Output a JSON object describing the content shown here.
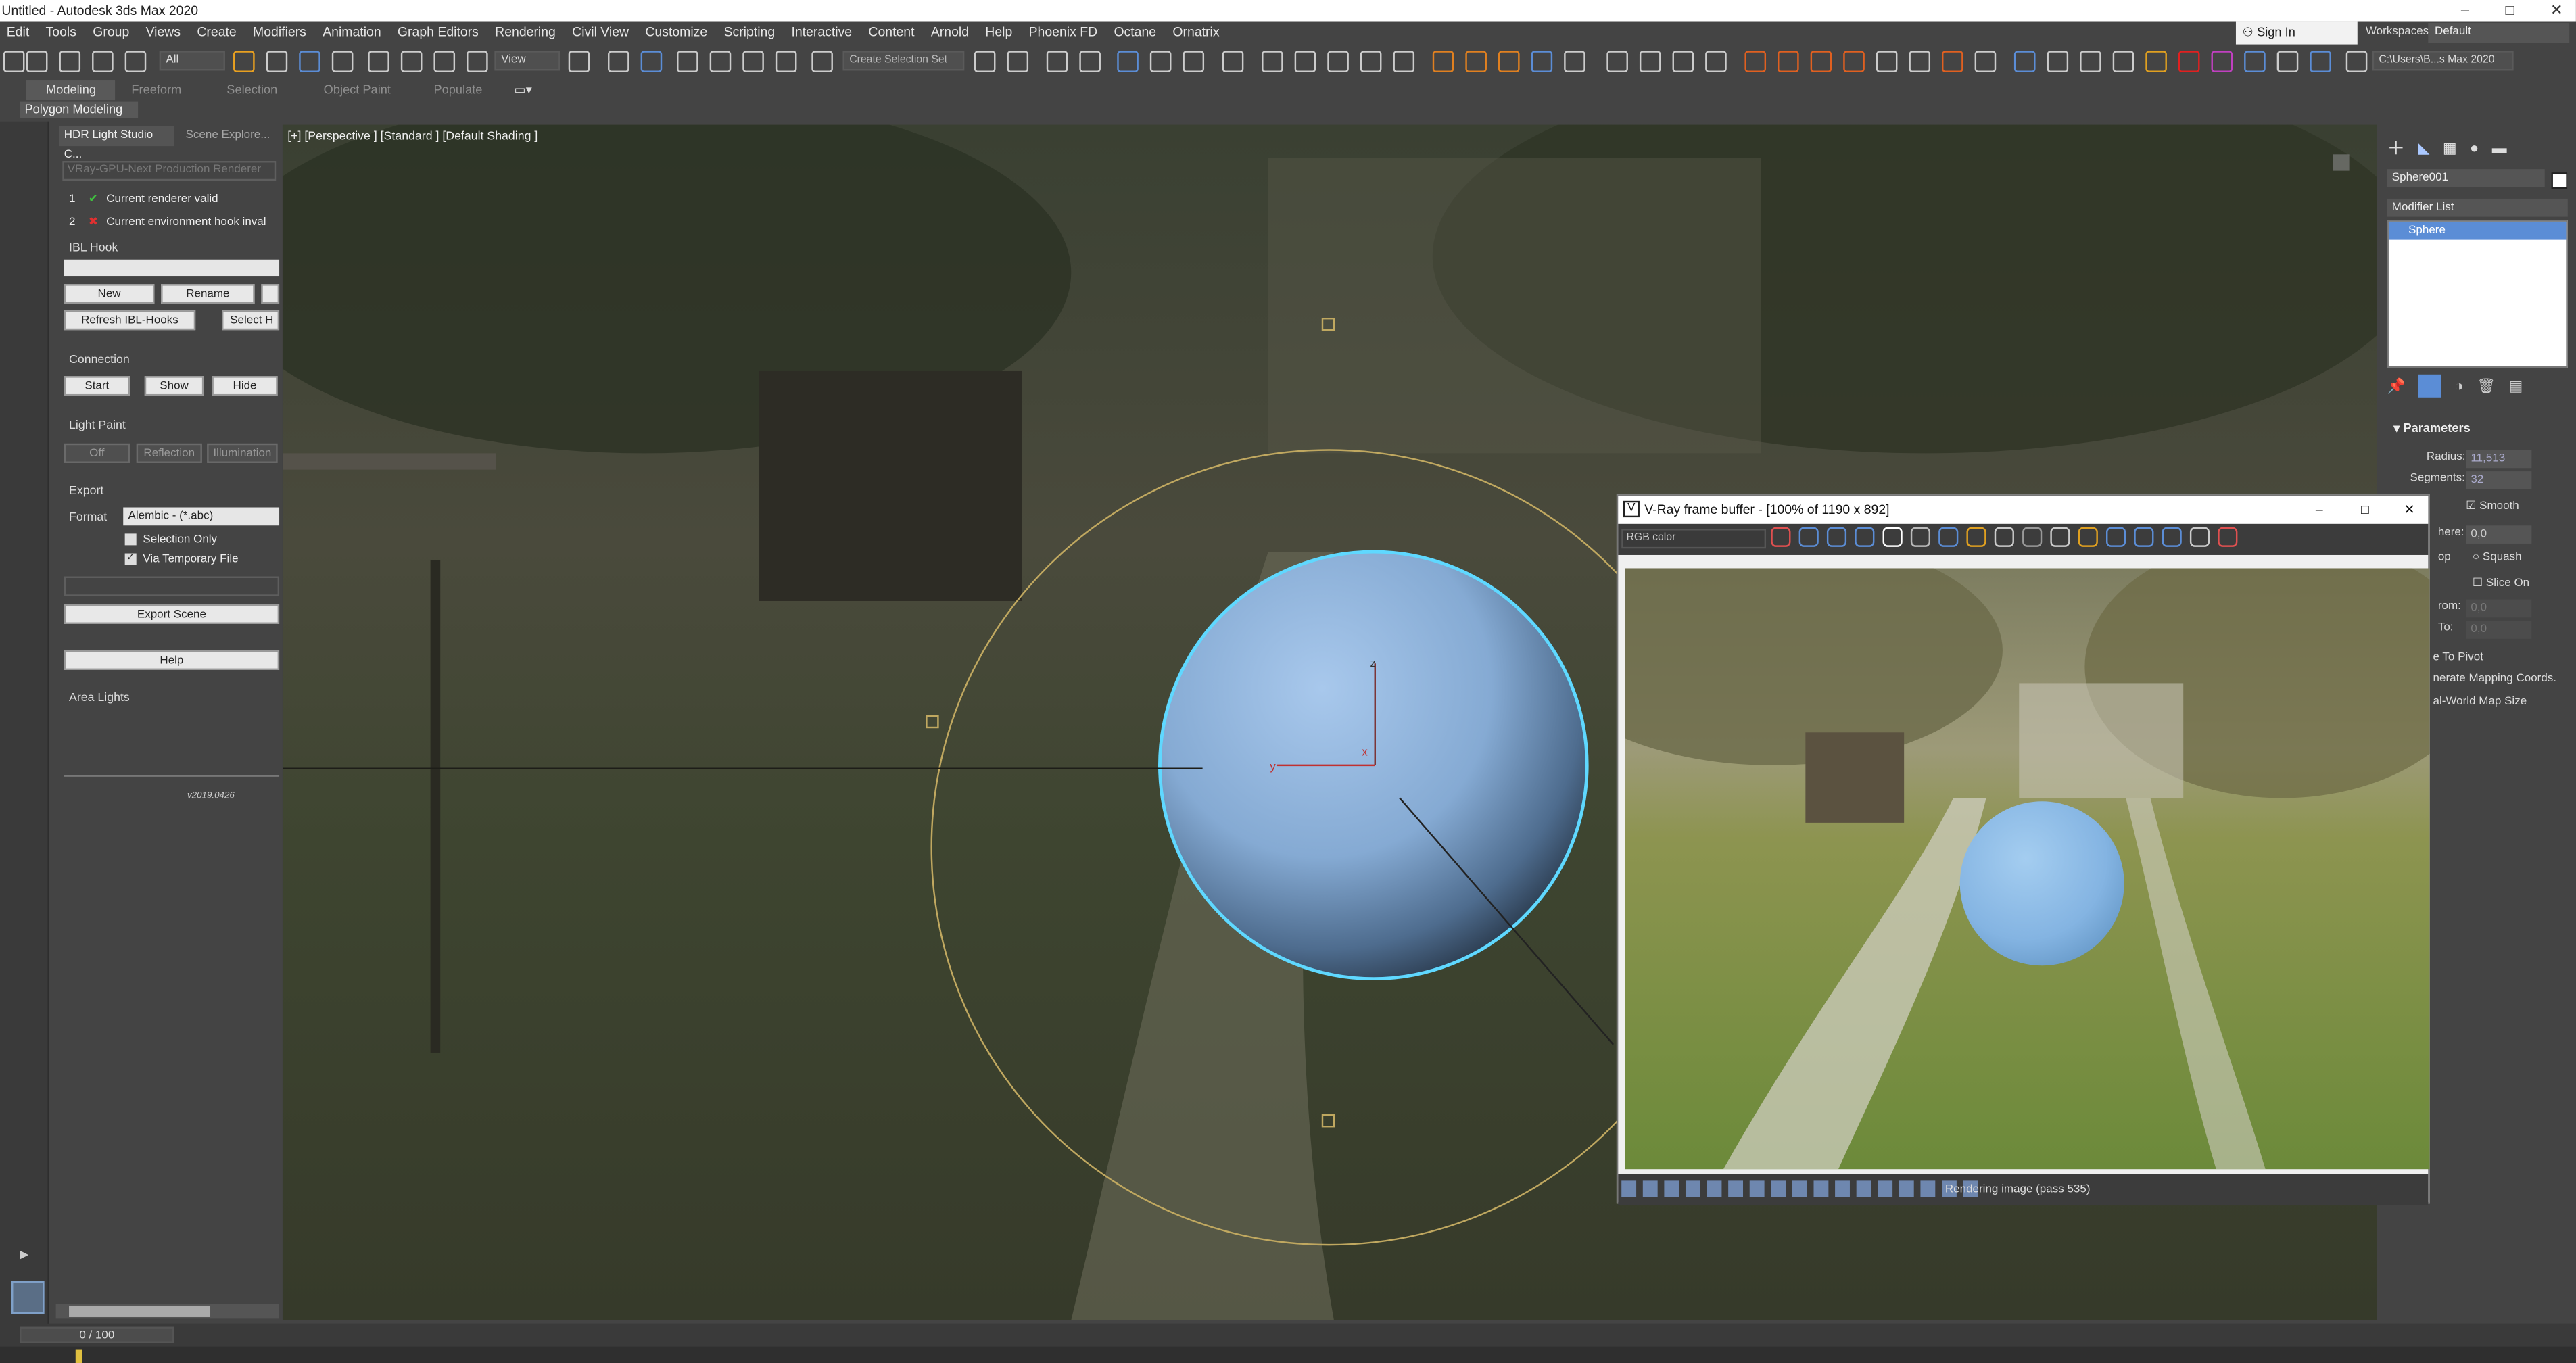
{
  "window": {
    "title": "Untitled - Autodesk 3ds Max 2020",
    "controls": [
      "–",
      "□",
      "✕"
    ]
  },
  "menu": [
    "Edit",
    "Tools",
    "Group",
    "Views",
    "Create",
    "Modifiers",
    "Animation",
    "Graph Editors",
    "Rendering",
    "Civil View",
    "Customize",
    "Scripting",
    "Interactive",
    "Content",
    "Arnold",
    "Help",
    "Phoenix FD",
    "Octane",
    "Ornatrix"
  ],
  "account": {
    "signin": "Sign In",
    "workspaces_label": "Workspaces:",
    "workspace": "Default"
  },
  "toolbar": {
    "selection_filter": "All",
    "view_dropdown": "View",
    "create_selection_set": "Create Selection Set",
    "project_path": "C:\\Users\\B...s Max 2020"
  },
  "ribbon": {
    "tabs": [
      "Modeling",
      "Freeform",
      "Selection",
      "Object Paint",
      "Populate"
    ],
    "active": "Modeling",
    "sub": "Polygon Modeling"
  },
  "hdr_panel": {
    "tabs": [
      "HDR Light Studio C...",
      "Scene Explore..."
    ],
    "renderer": "VRay-GPU-Next Production Renderer",
    "checks": [
      {
        "num": "1",
        "label": "Current renderer valid",
        "ok": true
      },
      {
        "num": "2",
        "label": "Current environment hook inval",
        "ok": false
      }
    ],
    "ibl_hook": "IBL Hook",
    "btn_new": "New",
    "btn_rename": "Rename",
    "btn_refresh": "Refresh IBL-Hooks",
    "btn_select": "Select H",
    "connection": "Connection",
    "btn_start": "Start",
    "btn_show": "Show",
    "btn_hide": "Hide",
    "light_paint": "Light Paint",
    "btn_off": "Off",
    "btn_reflection": "Reflection",
    "btn_illumination": "Illumination",
    "export": "Export",
    "format_label": "Format",
    "format_value": "Alembic - (*.abc)",
    "selection_only": "Selection Only",
    "via_temp": "Via Temporary File",
    "btn_export_scene": "Export Scene",
    "btn_help": "Help",
    "area_lights": "Area Lights",
    "version": "v2019.0426"
  },
  "viewport": {
    "label": "[+] [Perspective ] [Standard ] [Default Shading ]"
  },
  "command_panel": {
    "object_name": "Sphere001",
    "modifier_list": "Modifier List",
    "stack_item": "Sphere",
    "rollout": "Parameters",
    "radius_label": "Radius:",
    "radius": "11,513",
    "segments_label": "Segments:",
    "segments": "32",
    "smooth": "Smooth",
    "hemisphere_label": "here:",
    "hemisphere": "0,0",
    "chop": "op",
    "squash": "Squash",
    "slice_on": "Slice On",
    "slice_from_label": "rom:",
    "slice_from": "0,0",
    "slice_to_label": "To:",
    "slice_to": "0,0",
    "base_pivot": "e To Pivot",
    "gen_mapping": "nerate Mapping Coords.",
    "real_world": "al-World Map Size"
  },
  "vfb": {
    "title": "V-Ray frame buffer - [100% of 1190 x 892]",
    "channel": "RGB color",
    "status": "Rendering image (pass 535)"
  },
  "timeline": {
    "frame": "0 / 100"
  },
  "colors": {
    "selection_cyan": "#5fd8ff",
    "stack_highlight": "#5b8dd6",
    "sphere": "#8ab6e0"
  }
}
